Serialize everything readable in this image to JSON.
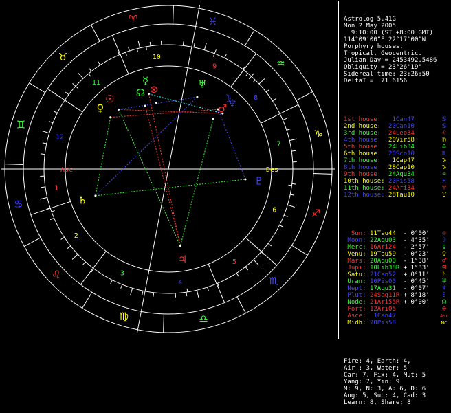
{
  "header": [
    {
      "text": "Astrolog 5.41G",
      "color": "#ffffff"
    },
    {
      "text": "Mon 2 May 2005",
      "color": "#ffffff"
    },
    {
      "text": "  9:10:00 (ST +8:00 GMT)",
      "color": "#ffffff"
    },
    {
      "text": "114°09'00\"E 22°17'00\"N",
      "color": "#ffffff"
    },
    {
      "text": "Porphyry houses.",
      "color": "#ffffff"
    },
    {
      "text": "Tropical, Geocentric.",
      "color": "#ffffff"
    },
    {
      "text": "Julian Day = 2453492.5486",
      "color": "#ffffff"
    },
    {
      "text": "Obliquity = 23°26'19\"",
      "color": "#ffffff"
    },
    {
      "text": "Sidereal time: 23:26:50",
      "color": "#ffffff"
    },
    {
      "text": "DeltaT =  71.6156",
      "color": "#ffffff"
    }
  ],
  "houses": [
    {
      "label": "1st house:",
      "value": " 1Can47",
      "label_color": "#ff3333",
      "value_color": "#4444ff",
      "glyph": "♋",
      "glyph_color": "#4444ff"
    },
    {
      "label": "2nd house:",
      "value": "20Can10",
      "label_color": "#ffff00",
      "value_color": "#4444ff",
      "glyph": "♋",
      "glyph_color": "#4444ff"
    },
    {
      "label": "3rd house:",
      "value": "24Leo34",
      "label_color": "#33ff33",
      "value_color": "#ff3333",
      "glyph": "♌",
      "glyph_color": "#ff3333"
    },
    {
      "label": "4th house:",
      "value": "20Vir58",
      "label_color": "#4444ff",
      "value_color": "#ffff00",
      "glyph": "♍",
      "glyph_color": "#ffff00"
    },
    {
      "label": "5th house:",
      "value": "24Lib34",
      "label_color": "#ff3333",
      "value_color": "#33ff33",
      "glyph": "♎",
      "glyph_color": "#33ff33"
    },
    {
      "label": "6th house:",
      "value": "20Sco10",
      "label_color": "#ffff00",
      "value_color": "#4444ff",
      "glyph": "♏",
      "glyph_color": "#4444ff"
    },
    {
      "label": "7th house:",
      "value": " 1Cap47",
      "label_color": "#33ff33",
      "value_color": "#ffff00",
      "glyph": "♑",
      "glyph_color": "#ffff00"
    },
    {
      "label": "8th house:",
      "value": "28Cap10",
      "label_color": "#4444ff",
      "value_color": "#ffff00",
      "glyph": "♑",
      "glyph_color": "#ffff00"
    },
    {
      "label": "9th house:",
      "value": "24Aqu34",
      "label_color": "#ff3333",
      "value_color": "#33ff33",
      "glyph": "♒",
      "glyph_color": "#33ff33"
    },
    {
      "label": "10th house:",
      "value": "20Pis58",
      "label_color": "#ffff00",
      "value_color": "#4444ff",
      "glyph": "♓",
      "glyph_color": "#4444ff"
    },
    {
      "label": "11th house:",
      "value": "24Ari34",
      "label_color": "#33ff33",
      "value_color": "#ff3333",
      "glyph": "♈",
      "glyph_color": "#ff3333"
    },
    {
      "label": "12th house:",
      "value": "28Tau10",
      "label_color": "#4444ff",
      "value_color": "#ffff00",
      "glyph": "♉",
      "glyph_color": "#ffff00"
    }
  ],
  "planets": [
    {
      "name": "Sun:",
      "pos": "11Tau44",
      "lat": "- 0°00'",
      "name_color": "#ff3333",
      "pos_color": "#ffff00",
      "glyph": "☉",
      "glyph_color": "#ff3333"
    },
    {
      "name": "Moon:",
      "pos": "22Aqu03",
      "lat": "- 4°35'",
      "name_color": "#4444ff",
      "pos_color": "#33ff33",
      "glyph": "☽",
      "glyph_color": "#4444ff"
    },
    {
      "name": "Merc:",
      "pos": "16Ari24",
      "lat": "- 2°57'",
      "name_color": "#33ff33",
      "pos_color": "#ff3333",
      "glyph": "☿",
      "glyph_color": "#33ff33"
    },
    {
      "name": "Venu:",
      "pos": "19Tau59",
      "lat": "- 0°23'",
      "name_color": "#ffff00",
      "pos_color": "#ffff00",
      "glyph": "♀",
      "glyph_color": "#ffff00"
    },
    {
      "name": "Mars:",
      "pos": "20Aqu00",
      "lat": "- 1°38'",
      "name_color": "#ff3333",
      "pos_color": "#33ff33",
      "glyph": "♂",
      "glyph_color": "#ff3333"
    },
    {
      "name": "Jupi:",
      "pos": "10Lib38R",
      "lat": "+ 1°33'",
      "name_color": "#ff3333",
      "pos_color": "#33ff33",
      "glyph": "♃",
      "glyph_color": "#ff3333"
    },
    {
      "name": "Satu:",
      "pos": "21Can52",
      "lat": "+ 0°11'",
      "name_color": "#ffff00",
      "pos_color": "#4444ff",
      "glyph": "♄",
      "glyph_color": "#ffff00"
    },
    {
      "name": "Uran:",
      "pos": "10Pis00",
      "lat": "- 0°45'",
      "name_color": "#33ff33",
      "pos_color": "#4444ff",
      "glyph": "♅",
      "glyph_color": "#33ff33"
    },
    {
      "name": "Nept:",
      "pos": "17Aqu31",
      "lat": "- 0°07'",
      "name_color": "#4444ff",
      "pos_color": "#33ff33",
      "glyph": "♆",
      "glyph_color": "#4444ff"
    },
    {
      "name": "Plut:",
      "pos": "24Sag11R",
      "lat": "+ 8°18'",
      "name_color": "#4444ff",
      "pos_color": "#ff3333",
      "glyph": "♇",
      "glyph_color": "#4444ff"
    },
    {
      "name": "Node:",
      "pos": "21Ari55R",
      "lat": "+ 0°00'",
      "name_color": "#33ff33",
      "pos_color": "#ff3333",
      "glyph": "☊",
      "glyph_color": "#33ff33"
    },
    {
      "name": "Fort:",
      "pos": "12Ari05",
      "lat": "",
      "name_color": "#ff3333",
      "pos_color": "#ff3333",
      "glyph": "⊗",
      "glyph_color": "#ff3333"
    },
    {
      "name": "Asce:",
      "pos": " 1Can47",
      "lat": "",
      "name_color": "#ff3333",
      "pos_color": "#4444ff",
      "glyph": "Asc",
      "glyph_color": "#ff3333"
    },
    {
      "name": "Midh:",
      "pos": "20Pis58",
      "lat": "",
      "name_color": "#ffff00",
      "pos_color": "#4444ff",
      "glyph": "MC",
      "glyph_color": "#ffff00"
    }
  ],
  "summary": [
    "Fire: 4, Earth: 4,",
    "Air : 3, Water: 5",
    "Car: 7, Fix: 4, Mut: 5",
    "Yang: 7, Yin: 9",
    "M: 9, N: 3, A: 6, D: 6",
    "Ang: 5, Suc: 4, Cad: 3",
    "Learn: 8, Share: 8"
  ],
  "wheel": {
    "asc_label": "Asc",
    "desc_label": "Des",
    "house_numbers": [
      "1",
      "2",
      "3",
      "4",
      "5",
      "6",
      "7",
      "8",
      "9",
      "10",
      "11",
      "12"
    ]
  },
  "colors": {
    "fire": "#ff3333",
    "earth": "#ffff00",
    "air": "#33ff33",
    "water": "#4444ff",
    "line": "#ffffff"
  }
}
